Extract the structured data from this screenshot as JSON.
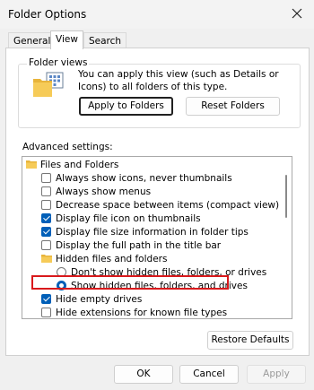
{
  "window": {
    "title": "Folder Options"
  },
  "tabs": [
    {
      "label": "General"
    },
    {
      "label": "View"
    },
    {
      "label": "Search"
    }
  ],
  "folder_views": {
    "group_label": "Folder views",
    "description": "You can apply this view (such as Details or Icons) to all folders of this type.",
    "apply_button": "Apply to Folders",
    "reset_button": "Reset Folders"
  },
  "advanced": {
    "label": "Advanced settings:",
    "items": [
      {
        "text": "Files and Folders",
        "type": "folder"
      },
      {
        "text": "Always show icons, never thumbnails",
        "type": "checkbox",
        "checked": false
      },
      {
        "text": "Always show menus",
        "type": "checkbox",
        "checked": false
      },
      {
        "text": "Decrease space between items (compact view)",
        "type": "checkbox",
        "checked": false
      },
      {
        "text": "Display file icon on thumbnails",
        "type": "checkbox",
        "checked": true
      },
      {
        "text": "Display file size information in folder tips",
        "type": "checkbox",
        "checked": true
      },
      {
        "text": "Display the full path in the title bar",
        "type": "checkbox",
        "checked": false
      },
      {
        "text": "Hidden files and folders",
        "type": "folder"
      },
      {
        "text": "Don't show hidden files, folders, or drives",
        "type": "radio",
        "checked": false
      },
      {
        "text": "Show hidden files, folders, and drives",
        "type": "radio",
        "checked": true
      },
      {
        "text": "Hide empty drives",
        "type": "checkbox",
        "checked": true
      },
      {
        "text": "Hide extensions for known file types",
        "type": "checkbox",
        "checked": false
      }
    ]
  },
  "restore_button": "Restore Defaults",
  "footer": {
    "ok": "OK",
    "cancel": "Cancel",
    "apply": "Apply"
  },
  "colors": {
    "accent": "#005fb8",
    "highlight": "#d9191c"
  }
}
